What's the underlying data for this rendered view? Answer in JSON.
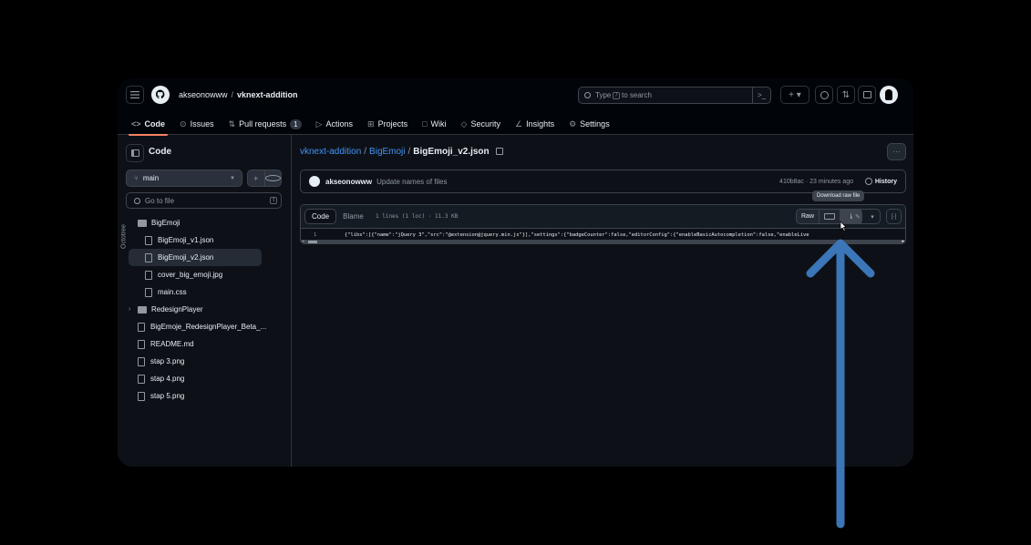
{
  "header": {
    "owner": "akseonowww",
    "separator": "/",
    "repo": "vknext-addition",
    "search_placeholder_pre": "Type",
    "search_kbd": "/",
    "search_placeholder_post": "to search",
    "cmd_icon": ">_"
  },
  "tabs": [
    {
      "label": "Code",
      "icon": "code-icon"
    },
    {
      "label": "Issues",
      "icon": "issue-icon"
    },
    {
      "label": "Pull requests",
      "icon": "pull-request-icon",
      "count": "1"
    },
    {
      "label": "Actions",
      "icon": "play-icon"
    },
    {
      "label": "Projects",
      "icon": "table-icon"
    },
    {
      "label": "Wiki",
      "icon": "book-icon"
    },
    {
      "label": "Security",
      "icon": "shield-icon"
    },
    {
      "label": "Insights",
      "icon": "graph-icon"
    },
    {
      "label": "Settings",
      "icon": "gear-icon"
    }
  ],
  "sidebar": {
    "title": "Code",
    "branch": "main",
    "goto_placeholder": "Go to file",
    "goto_kbd": "t",
    "octotree": "Octotree",
    "tree": [
      {
        "label": "BigEmoji",
        "type": "folder",
        "level": 0,
        "expanded": true
      },
      {
        "label": "BigEmoji_v1.json",
        "type": "file",
        "level": 1
      },
      {
        "label": "BigEmoji_v2.json",
        "type": "file",
        "level": 1,
        "selected": true
      },
      {
        "label": "cover_big_emoji.jpg",
        "type": "file",
        "level": 1
      },
      {
        "label": "main.css",
        "type": "file",
        "level": 1
      },
      {
        "label": "RedesignPlayer",
        "type": "folder",
        "level": 0,
        "expanded": false
      },
      {
        "label": "BigEmoje_RedesignPlayer_Beta_...",
        "type": "file",
        "level": 0
      },
      {
        "label": "README.md",
        "type": "file",
        "level": 0
      },
      {
        "label": "stap 3.png",
        "type": "file",
        "level": 0
      },
      {
        "label": "stap 4.png",
        "type": "file",
        "level": 0
      },
      {
        "label": "stap 5.png",
        "type": "file",
        "level": 0
      }
    ]
  },
  "main": {
    "crumbs": [
      "vknext-addition",
      "BigEmoji"
    ],
    "crumb_sep": "/",
    "file_name": "BigEmoji_v2.json",
    "commit": {
      "user": "akseonowww",
      "message": "Update names of files",
      "meta": "410b8ac · 23 minutes ago",
      "history_label": "History"
    },
    "file_view": {
      "tab_code": "Code",
      "tab_blame": "Blame",
      "info": "1 lines (1 loc) · 11.3 KB",
      "raw_label": "Raw",
      "line_number": "1",
      "line_text": "{\"libs\":[{\"name\":\"jQuery 3\",\"src\":\"@extension@jquery.min.js\"}],\"settings\":{\"badgeCounter\":false,\"editorConfig\":{\"enableBasicAutocompletion\":false,\"enableLive"
    },
    "tooltip": "Download raw file"
  },
  "colors": {
    "accent_blue": "#4493f8",
    "arrow_blue": "#3b76b8",
    "tab_underline": "#f78166"
  }
}
